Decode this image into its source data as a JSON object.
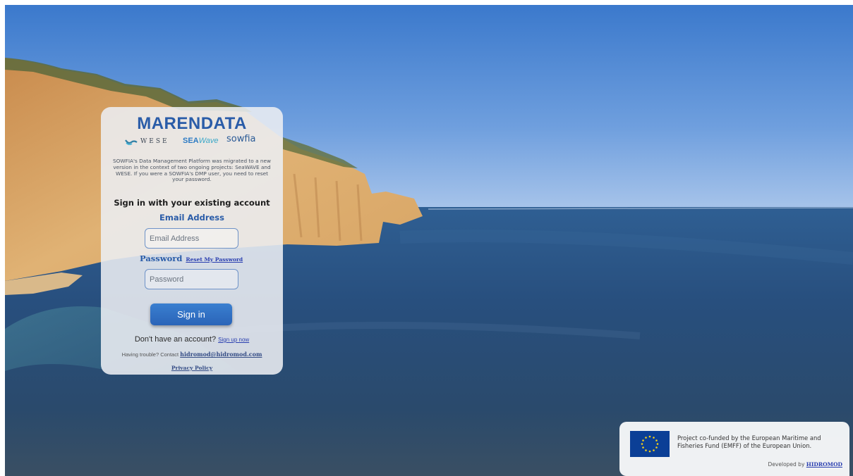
{
  "brand": {
    "title": "MARENDATA"
  },
  "partner_logos": {
    "wese": "WESE",
    "seawave": "SEA",
    "seawave_sub": "Wave",
    "sowfia": "sowfia"
  },
  "intro_text": "SOWFIA's Data Management Platform was migrated to a new version in the context of two ongoing projects: SeaWAVE and WESE. If you were a SOWFIA's DMP user, you need to reset your password.",
  "signin": {
    "heading": "Sign in with your existing account",
    "email_label": "Email Address",
    "email_placeholder": "Email Address",
    "password_label": "Password",
    "reset_link": "Reset My Password",
    "password_placeholder": "Password",
    "submit_label": "Sign in"
  },
  "signup": {
    "prompt": "Don't have an account?",
    "link": "Sign up now"
  },
  "support": {
    "prompt": "Having trouble? Contact",
    "email": "hidromod@hidromod.com"
  },
  "privacy": {
    "label": "Privacy Policy"
  },
  "funding": {
    "text": "Project co-funded by the European Maritime and Fisheries Fund (EMFF) of the European Union.",
    "developed_prefix": "Developed by",
    "developer": "HIDROMOD"
  },
  "colors": {
    "brand_blue": "#2a5ca8",
    "button_blue": "#2f6fc4",
    "eu_blue": "#0b3f96",
    "eu_star": "#f7d117"
  },
  "icons": {
    "background": "coastal-cliffs-sea-image",
    "wese_logo": "wave-icon",
    "eu_logo": "eu-flag-icon"
  }
}
